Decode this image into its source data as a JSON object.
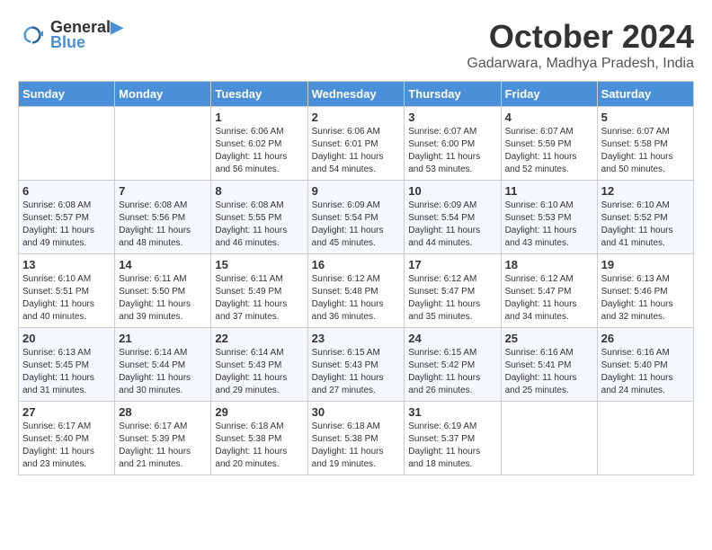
{
  "header": {
    "logo_line1": "General",
    "logo_line2": "Blue",
    "month": "October 2024",
    "location": "Gadarwara, Madhya Pradesh, India"
  },
  "weekdays": [
    "Sunday",
    "Monday",
    "Tuesday",
    "Wednesday",
    "Thursday",
    "Friday",
    "Saturday"
  ],
  "weeks": [
    [
      {
        "day": "",
        "sunrise": "",
        "sunset": "",
        "daylight": ""
      },
      {
        "day": "",
        "sunrise": "",
        "sunset": "",
        "daylight": ""
      },
      {
        "day": "1",
        "sunrise": "Sunrise: 6:06 AM",
        "sunset": "Sunset: 6:02 PM",
        "daylight": "Daylight: 11 hours and 56 minutes."
      },
      {
        "day": "2",
        "sunrise": "Sunrise: 6:06 AM",
        "sunset": "Sunset: 6:01 PM",
        "daylight": "Daylight: 11 hours and 54 minutes."
      },
      {
        "day": "3",
        "sunrise": "Sunrise: 6:07 AM",
        "sunset": "Sunset: 6:00 PM",
        "daylight": "Daylight: 11 hours and 53 minutes."
      },
      {
        "day": "4",
        "sunrise": "Sunrise: 6:07 AM",
        "sunset": "Sunset: 5:59 PM",
        "daylight": "Daylight: 11 hours and 52 minutes."
      },
      {
        "day": "5",
        "sunrise": "Sunrise: 6:07 AM",
        "sunset": "Sunset: 5:58 PM",
        "daylight": "Daylight: 11 hours and 50 minutes."
      }
    ],
    [
      {
        "day": "6",
        "sunrise": "Sunrise: 6:08 AM",
        "sunset": "Sunset: 5:57 PM",
        "daylight": "Daylight: 11 hours and 49 minutes."
      },
      {
        "day": "7",
        "sunrise": "Sunrise: 6:08 AM",
        "sunset": "Sunset: 5:56 PM",
        "daylight": "Daylight: 11 hours and 48 minutes."
      },
      {
        "day": "8",
        "sunrise": "Sunrise: 6:08 AM",
        "sunset": "Sunset: 5:55 PM",
        "daylight": "Daylight: 11 hours and 46 minutes."
      },
      {
        "day": "9",
        "sunrise": "Sunrise: 6:09 AM",
        "sunset": "Sunset: 5:54 PM",
        "daylight": "Daylight: 11 hours and 45 minutes."
      },
      {
        "day": "10",
        "sunrise": "Sunrise: 6:09 AM",
        "sunset": "Sunset: 5:54 PM",
        "daylight": "Daylight: 11 hours and 44 minutes."
      },
      {
        "day": "11",
        "sunrise": "Sunrise: 6:10 AM",
        "sunset": "Sunset: 5:53 PM",
        "daylight": "Daylight: 11 hours and 43 minutes."
      },
      {
        "day": "12",
        "sunrise": "Sunrise: 6:10 AM",
        "sunset": "Sunset: 5:52 PM",
        "daylight": "Daylight: 11 hours and 41 minutes."
      }
    ],
    [
      {
        "day": "13",
        "sunrise": "Sunrise: 6:10 AM",
        "sunset": "Sunset: 5:51 PM",
        "daylight": "Daylight: 11 hours and 40 minutes."
      },
      {
        "day": "14",
        "sunrise": "Sunrise: 6:11 AM",
        "sunset": "Sunset: 5:50 PM",
        "daylight": "Daylight: 11 hours and 39 minutes."
      },
      {
        "day": "15",
        "sunrise": "Sunrise: 6:11 AM",
        "sunset": "Sunset: 5:49 PM",
        "daylight": "Daylight: 11 hours and 37 minutes."
      },
      {
        "day": "16",
        "sunrise": "Sunrise: 6:12 AM",
        "sunset": "Sunset: 5:48 PM",
        "daylight": "Daylight: 11 hours and 36 minutes."
      },
      {
        "day": "17",
        "sunrise": "Sunrise: 6:12 AM",
        "sunset": "Sunset: 5:47 PM",
        "daylight": "Daylight: 11 hours and 35 minutes."
      },
      {
        "day": "18",
        "sunrise": "Sunrise: 6:12 AM",
        "sunset": "Sunset: 5:47 PM",
        "daylight": "Daylight: 11 hours and 34 minutes."
      },
      {
        "day": "19",
        "sunrise": "Sunrise: 6:13 AM",
        "sunset": "Sunset: 5:46 PM",
        "daylight": "Daylight: 11 hours and 32 minutes."
      }
    ],
    [
      {
        "day": "20",
        "sunrise": "Sunrise: 6:13 AM",
        "sunset": "Sunset: 5:45 PM",
        "daylight": "Daylight: 11 hours and 31 minutes."
      },
      {
        "day": "21",
        "sunrise": "Sunrise: 6:14 AM",
        "sunset": "Sunset: 5:44 PM",
        "daylight": "Daylight: 11 hours and 30 minutes."
      },
      {
        "day": "22",
        "sunrise": "Sunrise: 6:14 AM",
        "sunset": "Sunset: 5:43 PM",
        "daylight": "Daylight: 11 hours and 29 minutes."
      },
      {
        "day": "23",
        "sunrise": "Sunrise: 6:15 AM",
        "sunset": "Sunset: 5:43 PM",
        "daylight": "Daylight: 11 hours and 27 minutes."
      },
      {
        "day": "24",
        "sunrise": "Sunrise: 6:15 AM",
        "sunset": "Sunset: 5:42 PM",
        "daylight": "Daylight: 11 hours and 26 minutes."
      },
      {
        "day": "25",
        "sunrise": "Sunrise: 6:16 AM",
        "sunset": "Sunset: 5:41 PM",
        "daylight": "Daylight: 11 hours and 25 minutes."
      },
      {
        "day": "26",
        "sunrise": "Sunrise: 6:16 AM",
        "sunset": "Sunset: 5:40 PM",
        "daylight": "Daylight: 11 hours and 24 minutes."
      }
    ],
    [
      {
        "day": "27",
        "sunrise": "Sunrise: 6:17 AM",
        "sunset": "Sunset: 5:40 PM",
        "daylight": "Daylight: 11 hours and 23 minutes."
      },
      {
        "day": "28",
        "sunrise": "Sunrise: 6:17 AM",
        "sunset": "Sunset: 5:39 PM",
        "daylight": "Daylight: 11 hours and 21 minutes."
      },
      {
        "day": "29",
        "sunrise": "Sunrise: 6:18 AM",
        "sunset": "Sunset: 5:38 PM",
        "daylight": "Daylight: 11 hours and 20 minutes."
      },
      {
        "day": "30",
        "sunrise": "Sunrise: 6:18 AM",
        "sunset": "Sunset: 5:38 PM",
        "daylight": "Daylight: 11 hours and 19 minutes."
      },
      {
        "day": "31",
        "sunrise": "Sunrise: 6:19 AM",
        "sunset": "Sunset: 5:37 PM",
        "daylight": "Daylight: 11 hours and 18 minutes."
      },
      {
        "day": "",
        "sunrise": "",
        "sunset": "",
        "daylight": ""
      },
      {
        "day": "",
        "sunrise": "",
        "sunset": "",
        "daylight": ""
      }
    ]
  ]
}
